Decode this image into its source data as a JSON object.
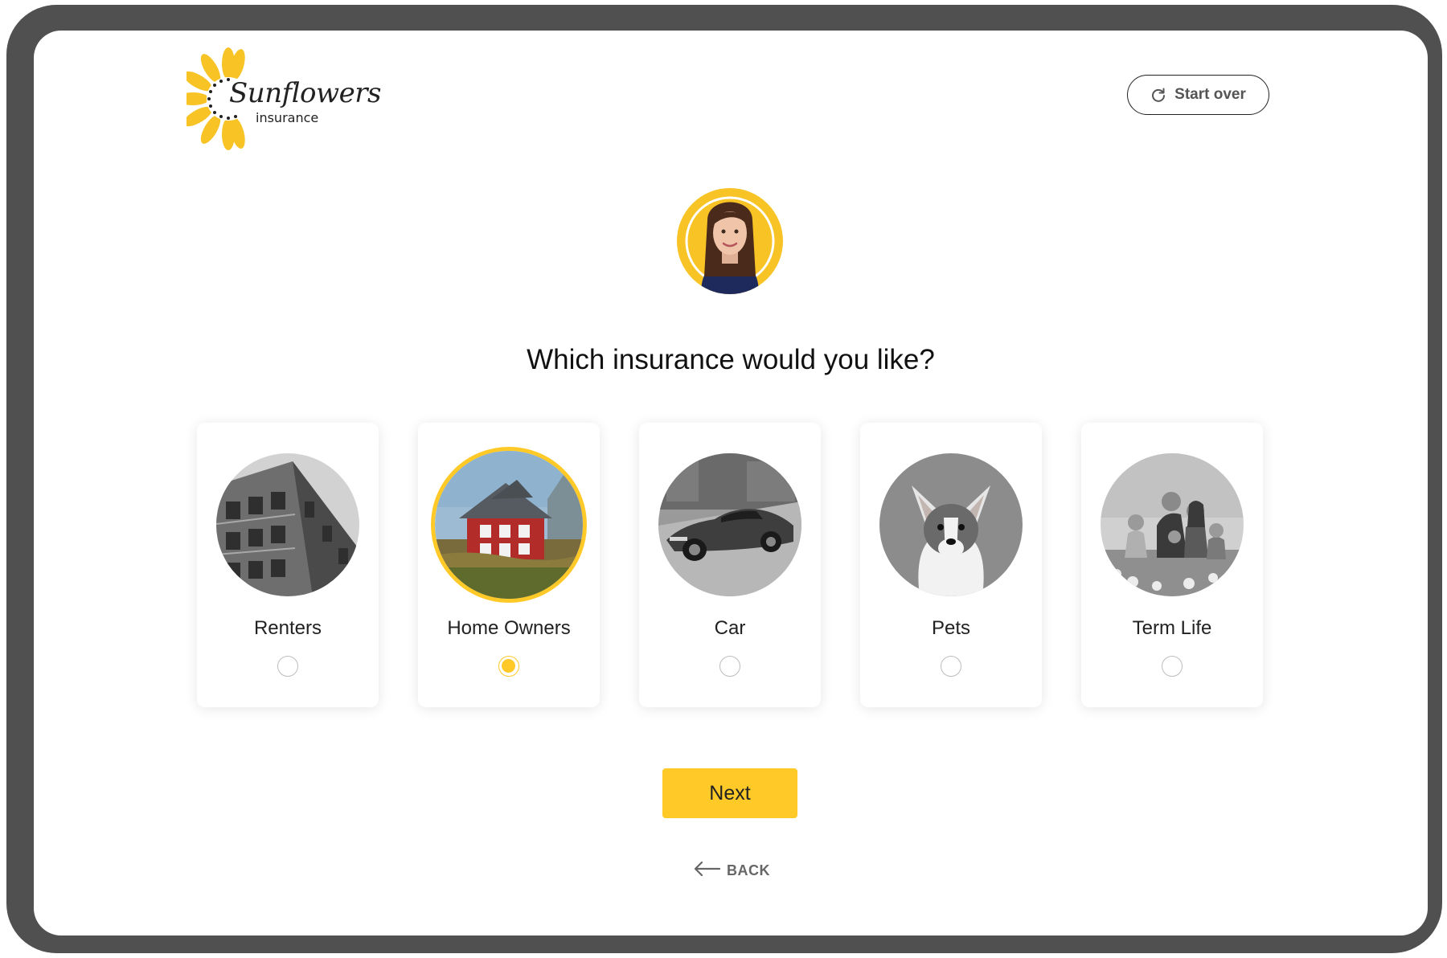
{
  "brand": {
    "name": "Sunflowers",
    "tagline": "insurance",
    "accent_color": "#ffc928"
  },
  "header": {
    "start_over_label": "Start over",
    "start_over_icon": "refresh-icon"
  },
  "assistant": {
    "avatar": "agent-avatar"
  },
  "question": "Which insurance would you like?",
  "options": [
    {
      "label": "Renters",
      "image": "apartment-building-photo",
      "selected": false
    },
    {
      "label": "Home Owners",
      "image": "house-photo",
      "selected": true
    },
    {
      "label": "Car",
      "image": "sports-car-photo",
      "selected": false
    },
    {
      "label": "Pets",
      "image": "corgi-dog-photo",
      "selected": false
    },
    {
      "label": "Term Life",
      "image": "family-photo",
      "selected": false
    }
  ],
  "actions": {
    "next_label": "Next",
    "back_label": "BACK",
    "back_icon": "arrow-left-icon"
  }
}
